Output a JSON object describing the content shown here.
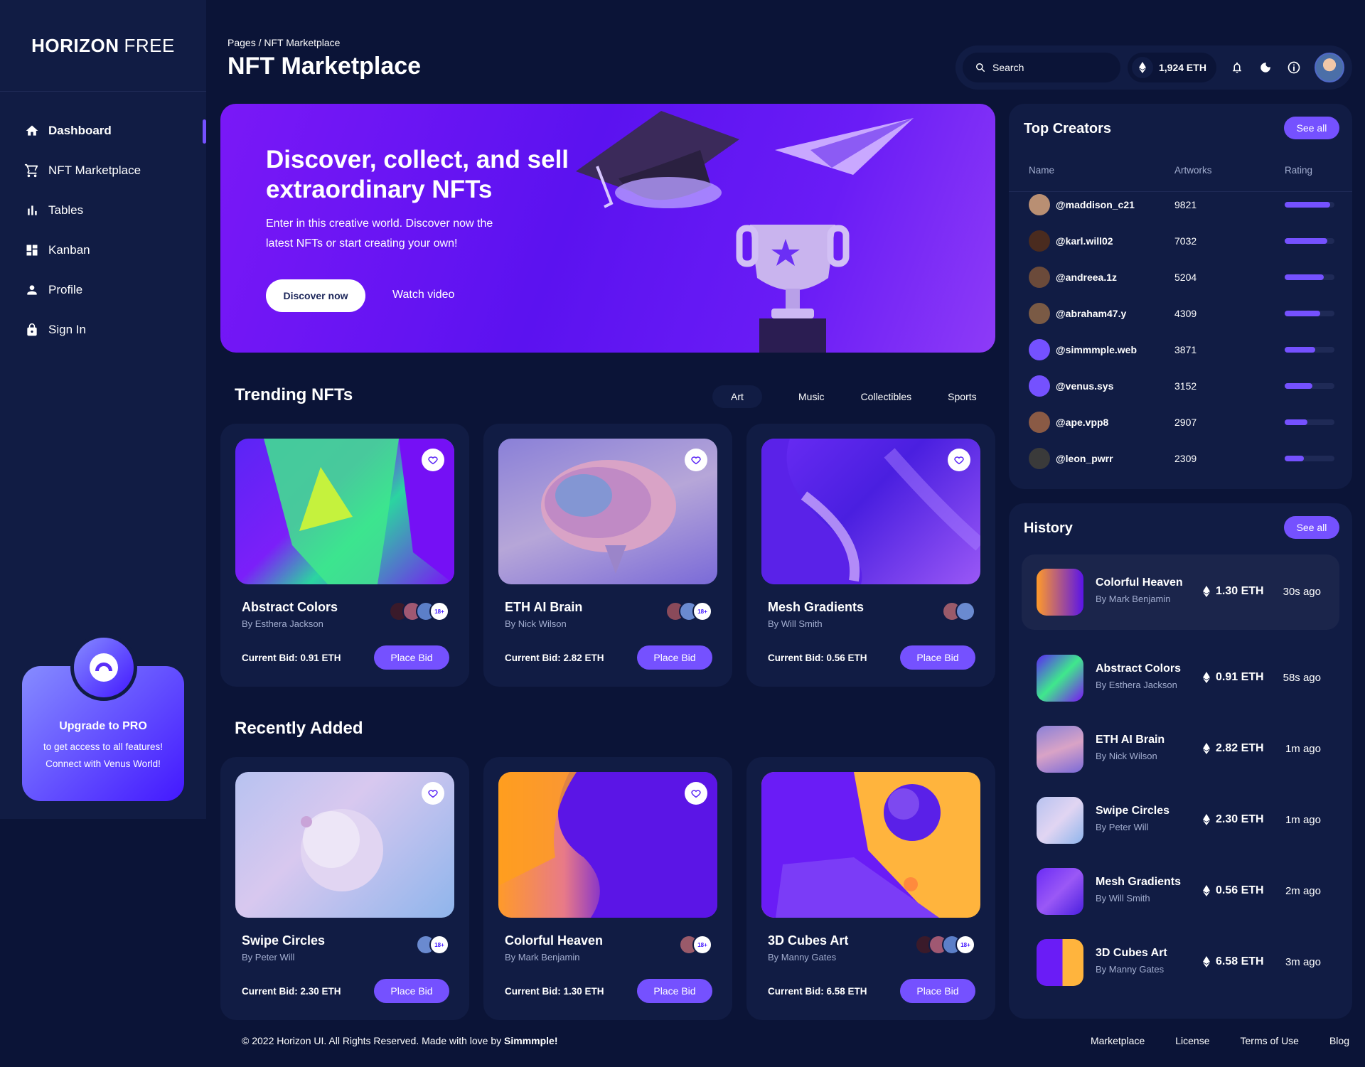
{
  "brand": {
    "bold": "HORIZON",
    "light": "FREE"
  },
  "sidebar": {
    "items": [
      {
        "label": "Dashboard",
        "icon": "home-icon",
        "active": true
      },
      {
        "label": "NFT Marketplace",
        "icon": "cart-icon"
      },
      {
        "label": "Tables",
        "icon": "bar-chart-icon"
      },
      {
        "label": "Kanban",
        "icon": "grid-icon"
      },
      {
        "label": "Profile",
        "icon": "person-icon"
      },
      {
        "label": "Sign In",
        "icon": "lock-icon"
      }
    ],
    "promo": {
      "title": "Upgrade to PRO",
      "line1": "to get access to all features!",
      "line2": "Connect with Venus World!"
    }
  },
  "header": {
    "breadcrumb": "Pages / NFT Marketplace",
    "title": "NFT Marketplace",
    "search_placeholder": "Search",
    "balance": "1,924 ETH"
  },
  "hero": {
    "title": "Discover, collect, and sell extraordinary NFTs",
    "text": "Enter in this creative world. Discover now the latest NFTs or start creating your own!",
    "primary_button": "Discover now",
    "secondary_button": "Watch video"
  },
  "trending": {
    "title": "Trending NFTs",
    "tabs": [
      "Art",
      "Music",
      "Collectibles",
      "Sports"
    ],
    "cards": [
      {
        "name": "Abstract Colors",
        "by": "By Esthera Jackson",
        "bid": "Current Bid: 0.91 ETH",
        "button": "Place Bid",
        "more": "18+"
      },
      {
        "name": "ETH AI Brain",
        "by": "By Nick Wilson",
        "bid": "Current Bid: 2.82 ETH",
        "button": "Place Bid",
        "more": "18+"
      },
      {
        "name": "Mesh Gradients",
        "by": "By Will Smith",
        "bid": "Current Bid: 0.56 ETH",
        "button": "Place Bid"
      }
    ]
  },
  "recent": {
    "title": "Recently Added",
    "cards": [
      {
        "name": "Swipe Circles",
        "by": "By Peter Will",
        "bid": "Current Bid: 2.30 ETH",
        "button": "Place Bid",
        "more": "18+"
      },
      {
        "name": "Colorful Heaven",
        "by": "By Mark Benjamin",
        "bid": "Current Bid: 1.30 ETH",
        "button": "Place Bid",
        "more": "18+"
      },
      {
        "name": "3D Cubes Art",
        "by": "By Manny Gates",
        "bid": "Current Bid: 6.58 ETH",
        "button": "Place Bid",
        "more": "18+"
      }
    ]
  },
  "top_creators": {
    "title": "Top Creators",
    "see_all": "See all",
    "columns": [
      "Name",
      "Artworks",
      "Rating"
    ],
    "rows": [
      {
        "name": "@maddison_c21",
        "artworks": "9821",
        "rating": 0.92
      },
      {
        "name": "@karl.will02",
        "artworks": "7032",
        "rating": 0.85
      },
      {
        "name": "@andreea.1z",
        "artworks": "5204",
        "rating": 0.78
      },
      {
        "name": "@abraham47.y",
        "artworks": "4309",
        "rating": 0.72
      },
      {
        "name": "@simmmple.web",
        "artworks": "3871",
        "rating": 0.62
      },
      {
        "name": "@venus.sys",
        "artworks": "3152",
        "rating": 0.56
      },
      {
        "name": "@ape.vpp8",
        "artworks": "2907",
        "rating": 0.46
      },
      {
        "name": "@leon_pwrr",
        "artworks": "2309",
        "rating": 0.38
      }
    ]
  },
  "history": {
    "title": "History",
    "see_all": "See all",
    "items": [
      {
        "name": "Colorful Heaven",
        "by": "By Mark Benjamin",
        "eth": "1.30 ETH",
        "time": "30s ago"
      },
      {
        "name": "Abstract Colors",
        "by": "By Esthera Jackson",
        "eth": "0.91 ETH",
        "time": "58s ago"
      },
      {
        "name": "ETH AI Brain",
        "by": "By Nick Wilson",
        "eth": "2.82 ETH",
        "time": "1m ago"
      },
      {
        "name": "Swipe Circles",
        "by": "By Peter Will",
        "eth": "2.30 ETH",
        "time": "1m ago"
      },
      {
        "name": "Mesh Gradients",
        "by": "By Will Smith",
        "eth": "0.56 ETH",
        "time": "2m ago"
      },
      {
        "name": "3D Cubes Art",
        "by": "By Manny Gates",
        "eth": "6.58 ETH",
        "time": "3m ago"
      }
    ]
  },
  "footer": {
    "copyright": "© 2022 Horizon UI. All Rights Reserved. Made with love by",
    "author": "Simmmple!",
    "links": [
      "Marketplace",
      "License",
      "Terms of Use",
      "Blog"
    ]
  },
  "colors": {
    "background": "#0b1437",
    "card": "#111c44",
    "accent": "#7551ff"
  }
}
